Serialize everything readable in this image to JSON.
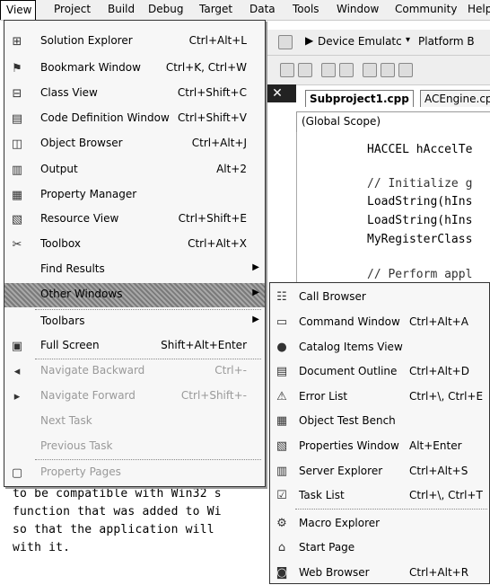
{
  "menubar": {
    "items": [
      "View",
      "Project",
      "Build",
      "Debug",
      "Target",
      "Data",
      "Tools",
      "Window",
      "Community",
      "Help"
    ]
  },
  "toolbar": {
    "device_label": "Device Emulatc",
    "platform_label": "Platform B"
  },
  "editor": {
    "close_glyph": "✕",
    "tabs": [
      "Subproject1.cpp",
      "ACEngine.cp"
    ],
    "scope": "(Global Scope)",
    "code_lines": [
      "HACCEL hAccelTe",
      "",
      "// Initialize g",
      "LoadString(hIns",
      "LoadString(hIns",
      "MyRegisterClass",
      "",
      "// Perform appl"
    ]
  },
  "body_text": {
    "lines": [
      "to be compatible with Win32 s",
      "function that was added to Wi",
      "so that the application will",
      "with it."
    ]
  },
  "view_menu": {
    "items": [
      {
        "label": "Solution Explorer",
        "shortcut": "Ctrl+Alt+L",
        "icon": "solution-explorer-icon",
        "glyph": "⊞"
      },
      {
        "label": "Bookmark Window",
        "shortcut": "Ctrl+K, Ctrl+W",
        "icon": "bookmark-window-icon",
        "glyph": "⚑"
      },
      {
        "label": "Class View",
        "shortcut": "Ctrl+Shift+C",
        "icon": "class-view-icon",
        "glyph": "⊟"
      },
      {
        "label": "Code Definition Window",
        "shortcut": "Ctrl+Shift+V",
        "icon": "code-definition-icon",
        "glyph": "▤"
      },
      {
        "label": "Object Browser",
        "shortcut": "Ctrl+Alt+J",
        "icon": "object-browser-icon",
        "glyph": "◫"
      },
      {
        "label": "Output",
        "shortcut": "Alt+2",
        "icon": "output-icon",
        "glyph": "▥"
      },
      {
        "label": "Property Manager",
        "shortcut": "",
        "icon": "property-manager-icon",
        "glyph": "▦"
      },
      {
        "label": "Resource View",
        "shortcut": "Ctrl+Shift+E",
        "icon": "resource-view-icon",
        "glyph": "▧"
      },
      {
        "label": "Toolbox",
        "shortcut": "Ctrl+Alt+X",
        "icon": "toolbox-icon",
        "glyph": "✂"
      },
      {
        "label": "Find Results",
        "shortcut": "",
        "icon": "",
        "glyph": ""
      },
      {
        "label": "Other Windows",
        "shortcut": "",
        "icon": "",
        "glyph": ""
      },
      {
        "label": "Toolbars",
        "shortcut": "",
        "icon": "",
        "glyph": ""
      },
      {
        "label": "Full Screen",
        "shortcut": "Shift+Alt+Enter",
        "icon": "full-screen-icon",
        "glyph": "▣"
      },
      {
        "label": "Navigate Backward",
        "shortcut": "Ctrl+-",
        "icon": "navigate-backward-icon",
        "glyph": "◂"
      },
      {
        "label": "Navigate Forward",
        "shortcut": "Ctrl+Shift+-",
        "icon": "navigate-forward-icon",
        "glyph": "▸"
      },
      {
        "label": "Next Task",
        "shortcut": "",
        "icon": "",
        "glyph": ""
      },
      {
        "label": "Previous Task",
        "shortcut": "",
        "icon": "",
        "glyph": ""
      },
      {
        "label": "Property Pages",
        "shortcut": "",
        "icon": "property-pages-icon",
        "glyph": "▢"
      }
    ]
  },
  "submenu": {
    "items": [
      {
        "label": "Call Browser",
        "shortcut": "",
        "icon": "call-browser-icon",
        "glyph": "☷"
      },
      {
        "label": "Command Window",
        "shortcut": "Ctrl+Alt+A",
        "icon": "command-window-icon",
        "glyph": "▭"
      },
      {
        "label": "Catalog Items View",
        "shortcut": "",
        "icon": "catalog-items-icon",
        "glyph": "●"
      },
      {
        "label": "Document Outline",
        "shortcut": "Ctrl+Alt+D",
        "icon": "document-outline-icon",
        "glyph": "▤"
      },
      {
        "label": "Error List",
        "shortcut": "Ctrl+\\, Ctrl+E",
        "icon": "error-list-icon",
        "glyph": "⚠"
      },
      {
        "label": "Object Test Bench",
        "shortcut": "",
        "icon": "object-test-bench-icon",
        "glyph": "▦"
      },
      {
        "label": "Properties Window",
        "shortcut": "Alt+Enter",
        "icon": "properties-window-icon",
        "glyph": "▧"
      },
      {
        "label": "Server Explorer",
        "shortcut": "Ctrl+Alt+S",
        "icon": "server-explorer-icon",
        "glyph": "▥"
      },
      {
        "label": "Task List",
        "shortcut": "Ctrl+\\, Ctrl+T",
        "icon": "task-list-icon",
        "glyph": "☑"
      },
      {
        "label": "Macro Explorer",
        "shortcut": "",
        "icon": "macro-explorer-icon",
        "glyph": "⚙"
      },
      {
        "label": "Start Page",
        "shortcut": "",
        "icon": "start-page-icon",
        "glyph": "⌂"
      },
      {
        "label": "Web Browser",
        "shortcut": "Ctrl+Alt+R",
        "icon": "web-browser-icon",
        "glyph": "◙"
      }
    ]
  }
}
